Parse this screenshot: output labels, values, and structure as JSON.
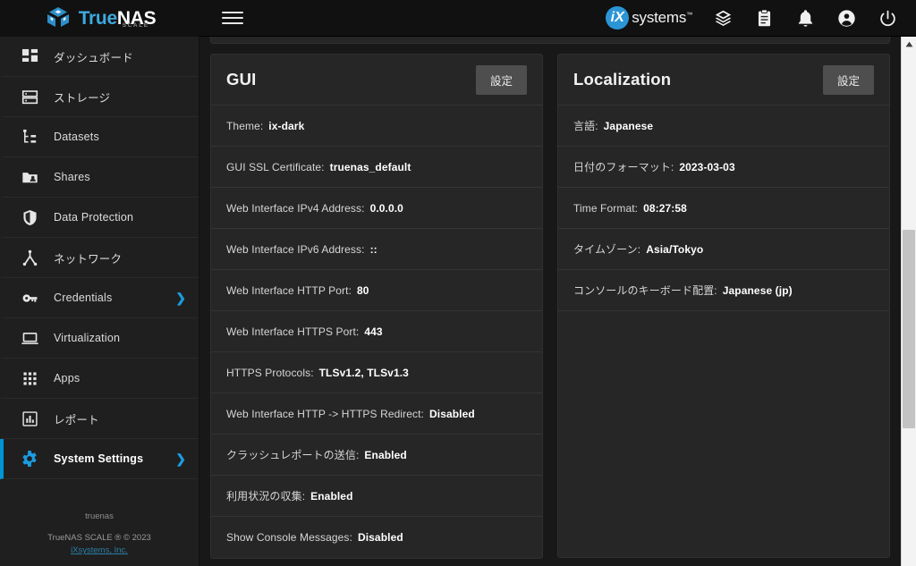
{
  "brand": {
    "name_part1": "True",
    "name_part2": "NAS",
    "sub": "SCALE",
    "logo_icon": "truenas-cube-logo"
  },
  "topbar": {
    "menu_icon": "hamburger-menu-icon",
    "vendor_mark": "iX",
    "vendor_name": "systems",
    "vendor_trademark": "™",
    "icons": [
      {
        "name": "ix-apps-icon",
        "label": "iXsystems Apps"
      },
      {
        "name": "jobs-clipboard-icon",
        "label": "Jobs"
      },
      {
        "name": "alerts-bell-icon",
        "label": "Alerts"
      },
      {
        "name": "account-user-icon",
        "label": "Account"
      },
      {
        "name": "power-icon",
        "label": "Power"
      }
    ]
  },
  "sidebar": {
    "items": [
      {
        "label": "ダッシュボード",
        "icon": "dashboard-icon",
        "expandable": false,
        "active": false
      },
      {
        "label": "ストレージ",
        "icon": "storage-icon",
        "expandable": false,
        "active": false
      },
      {
        "label": "Datasets",
        "icon": "datasets-tree-icon",
        "expandable": false,
        "active": false
      },
      {
        "label": "Shares",
        "icon": "shares-folder-icon",
        "expandable": false,
        "active": false
      },
      {
        "label": "Data Protection",
        "icon": "shield-icon",
        "expandable": false,
        "active": false
      },
      {
        "label": "ネットワーク",
        "icon": "network-icon",
        "expandable": false,
        "active": false
      },
      {
        "label": "Credentials",
        "icon": "key-icon",
        "expandable": true,
        "active": false
      },
      {
        "label": "Virtualization",
        "icon": "monitor-icon",
        "expandable": false,
        "active": false
      },
      {
        "label": "Apps",
        "icon": "apps-grid-icon",
        "expandable": false,
        "active": false
      },
      {
        "label": "レポート",
        "icon": "reports-chart-icon",
        "expandable": false,
        "active": false
      },
      {
        "label": "System Settings",
        "icon": "gear-icon",
        "expandable": true,
        "active": true
      }
    ],
    "chevron_icon": "chevron-right-icon",
    "footer": {
      "hostname": "truenas",
      "copyright": "TrueNAS SCALE ® © 2023",
      "link": "iXsystems, Inc."
    }
  },
  "main": {
    "cards": [
      {
        "title": "GUI",
        "button_label": "設定",
        "rows": [
          {
            "key": "Theme:",
            "value": "ix-dark"
          },
          {
            "key": "GUI SSL Certificate:",
            "value": "truenas_default"
          },
          {
            "key": "Web Interface IPv4 Address:",
            "value": "0.0.0.0"
          },
          {
            "key": "Web Interface IPv6 Address:",
            "value": "::"
          },
          {
            "key": "Web Interface HTTP Port:",
            "value": "80"
          },
          {
            "key": "Web Interface HTTPS Port:",
            "value": "443"
          },
          {
            "key": "HTTPS Protocols:",
            "value": "TLSv1.2, TLSv1.3"
          },
          {
            "key": "Web Interface HTTP -> HTTPS Redirect:",
            "value": "Disabled"
          },
          {
            "key": "クラッシュレポートの送信:",
            "value": "Enabled"
          },
          {
            "key": "利用状況の収集:",
            "value": "Enabled"
          },
          {
            "key": "Show Console Messages:",
            "value": "Disabled"
          }
        ]
      },
      {
        "title": "Localization",
        "button_label": "設定",
        "rows": [
          {
            "key": "言語:",
            "value": "Japanese"
          },
          {
            "key": "日付のフォーマット:",
            "value": "2023-03-03"
          },
          {
            "key": "Time Format:",
            "value": "08:27:58"
          },
          {
            "key": "タイムゾーン:",
            "value": "Asia/Tokyo"
          },
          {
            "key": "コンソールのキーボード配置:",
            "value": "Japanese (jp)"
          }
        ]
      }
    ]
  },
  "scrollbar": {
    "up_arrow_icon": "scroll-up-arrow-icon"
  },
  "colors": {
    "accent": "#0095d5",
    "brand_blue": "#3fa9e0",
    "card_bg": "#262626",
    "sidebar_bg": "#1f1f1f",
    "page_bg": "#181818",
    "topbar_bg": "#111111",
    "link": "#2b7fa8"
  }
}
